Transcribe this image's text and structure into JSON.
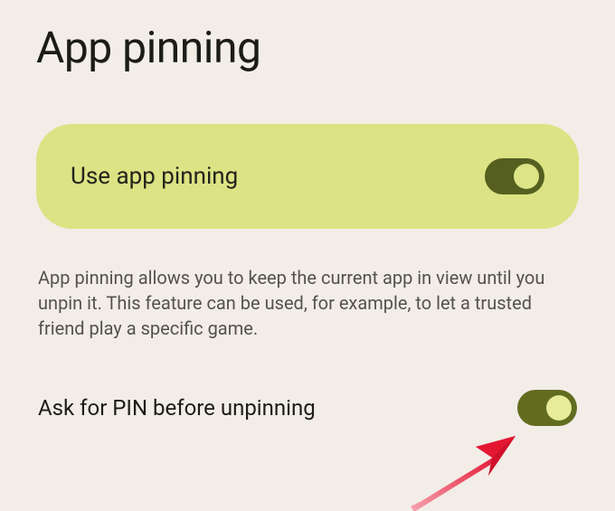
{
  "page": {
    "title": "App pinning"
  },
  "mainToggle": {
    "label": "Use app pinning",
    "on": true
  },
  "description": "App pinning allows you to keep the current app in view until you unpin it. This feature can be used, for example, to let a trusted friend play a specific game.",
  "secondaryToggle": {
    "label": "Ask for PIN before unpinning",
    "on": true
  }
}
